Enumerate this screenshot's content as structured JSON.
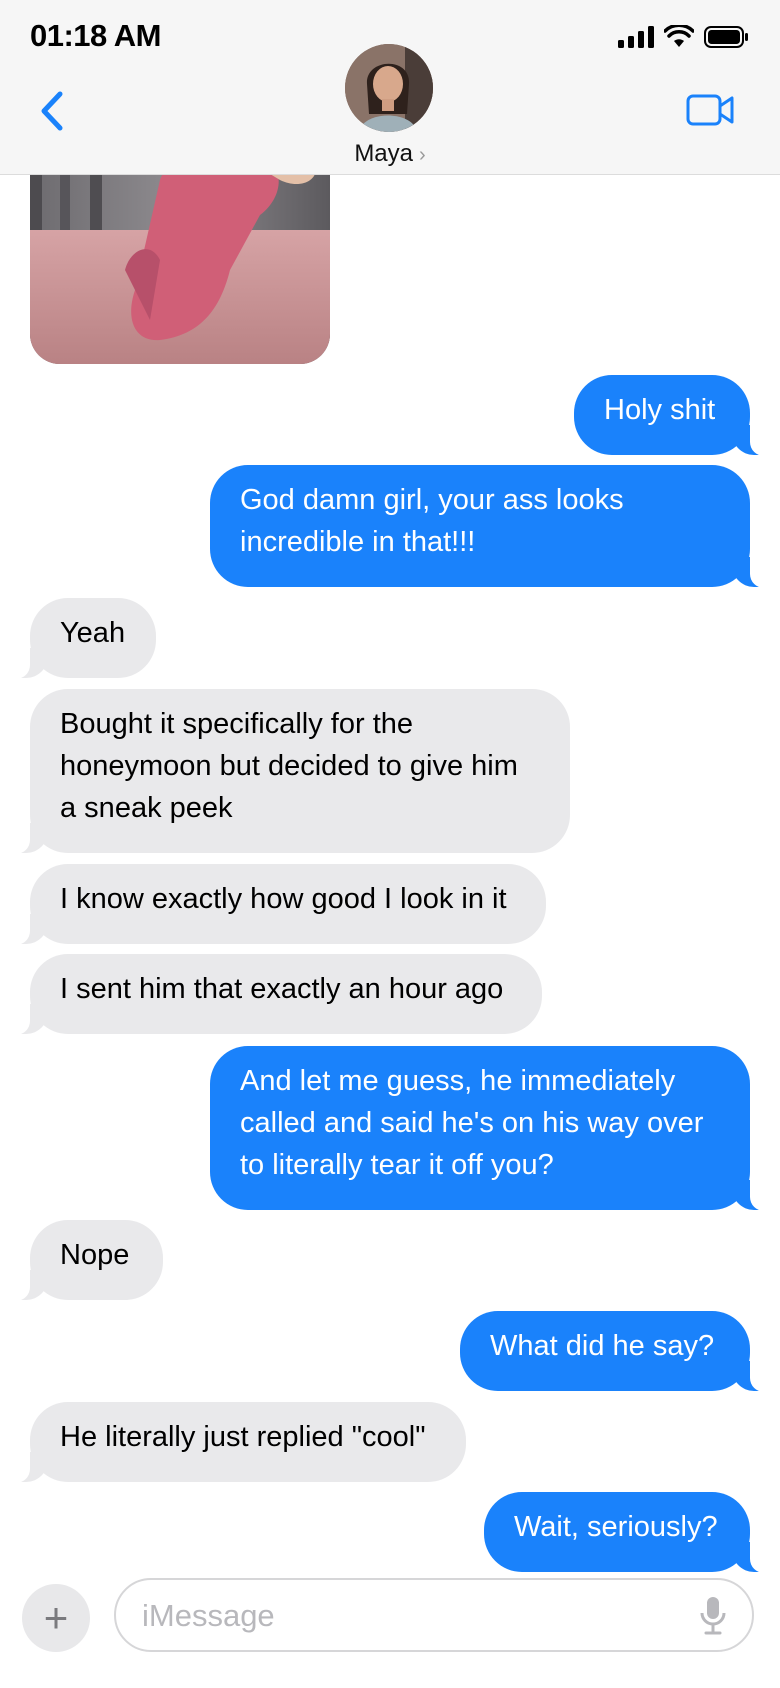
{
  "status_bar": {
    "time": "01:18 AM"
  },
  "contact": {
    "name": "Maya",
    "chevron": "›"
  },
  "icons": {
    "back": "chevron-left-icon",
    "video": "video-camera-icon",
    "plus": "plus-icon",
    "mic": "microphone-icon"
  },
  "colors": {
    "accent": "#1a82fb",
    "incoming": "#e9e9eb",
    "header": "#f6f6f6"
  },
  "messages": [
    {
      "side": "out",
      "text": "Holy shit"
    },
    {
      "side": "out",
      "text": "God damn girl, your ass looks incredible in that!!!"
    },
    {
      "side": "in",
      "text": "Yeah"
    },
    {
      "side": "in",
      "text": "Bought it specifically for the honeymoon but decided to give him a sneak peek"
    },
    {
      "side": "in",
      "text": "I know exactly how good I look in it"
    },
    {
      "side": "in",
      "text": "I sent him that exactly an hour ago"
    },
    {
      "side": "out",
      "text": "And let me guess, he immediately called and said he's on his way over to literally tear it off you?"
    },
    {
      "side": "in",
      "text": "Nope"
    },
    {
      "side": "out",
      "text": "What did he say?"
    },
    {
      "side": "in",
      "text": "He literally just replied \"cool\""
    },
    {
      "side": "out",
      "text": "Wait, seriously?"
    }
  ],
  "composer": {
    "placeholder": "iMessage",
    "plus_label": "+"
  }
}
